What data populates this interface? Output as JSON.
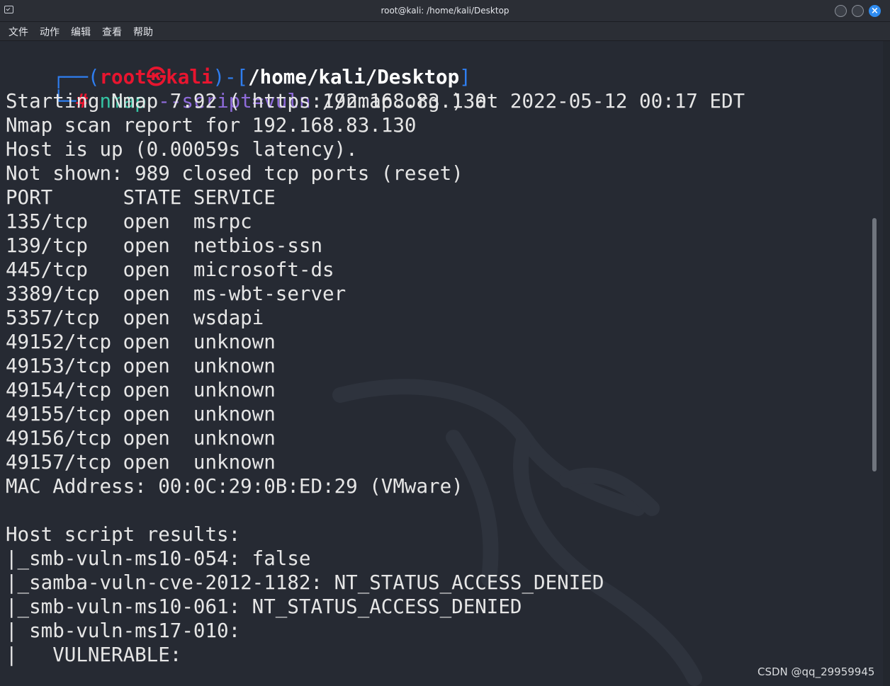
{
  "window": {
    "title": "root@kali: /home/kali/Desktop",
    "close_glyph": "×"
  },
  "menu": [
    "文件",
    "动作",
    "编辑",
    "查看",
    "帮助"
  ],
  "prompt": {
    "corner_top": "┌──(",
    "user": "root",
    "at_symbol": "㉿",
    "host": "kali",
    "sep": ")-[",
    "path": "/home/kali/Desktop",
    "close": "]",
    "corner_bottom": "└─",
    "hash": "#",
    "cmd": "nmap",
    "opt": "--script=vuln",
    "target": "192.168.83.130"
  },
  "output": [
    "Starting Nmap 7.92 ( https://nmap.org ) at 2022-05-12 00:17 EDT",
    "Nmap scan report for 192.168.83.130",
    "Host is up (0.00059s latency).",
    "Not shown: 989 closed tcp ports (reset)",
    "PORT      STATE SERVICE",
    "135/tcp   open  msrpc",
    "139/tcp   open  netbios-ssn",
    "445/tcp   open  microsoft-ds",
    "3389/tcp  open  ms-wbt-server",
    "5357/tcp  open  wsdapi",
    "49152/tcp open  unknown",
    "49153/tcp open  unknown",
    "49154/tcp open  unknown",
    "49155/tcp open  unknown",
    "49156/tcp open  unknown",
    "49157/tcp open  unknown",
    "MAC Address: 00:0C:29:0B:ED:29 (VMware)",
    "",
    "Host script results:",
    "|_smb-vuln-ms10-054: false",
    "|_samba-vuln-cve-2012-1182: NT_STATUS_ACCESS_DENIED",
    "|_smb-vuln-ms10-061: NT_STATUS_ACCESS_DENIED",
    "| smb-vuln-ms17-010:",
    "|   VULNERABLE:"
  ],
  "watermark": "CSDN @qq_29959945"
}
